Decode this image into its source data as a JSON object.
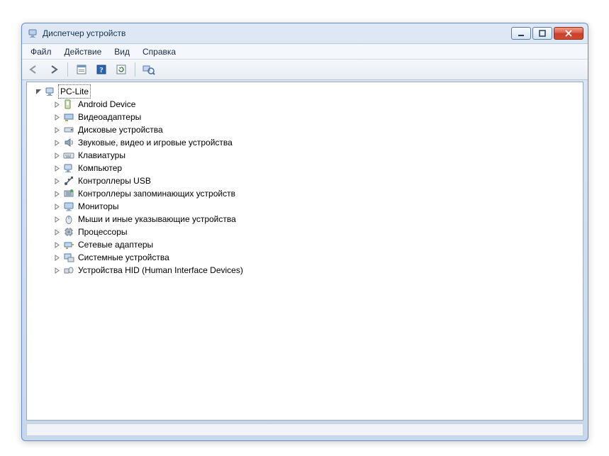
{
  "window": {
    "title": "Диспетчер устройств"
  },
  "menu": {
    "file": "Файл",
    "action": "Действие",
    "view": "Вид",
    "help": "Справка"
  },
  "toolbar": {
    "back": "Назад",
    "forward": "Вперёд",
    "properties": "Свойства",
    "help": "Справка",
    "update": "Обновить конфигурацию",
    "scan": "Обновить конфигурацию оборудования"
  },
  "tree": {
    "root": {
      "label": "PC-Lite",
      "icon": "computer-icon",
      "expanded": true
    },
    "items": [
      {
        "label": "Android Device",
        "icon": "device-icon"
      },
      {
        "label": "Видеоадаптеры",
        "icon": "display-adapter-icon"
      },
      {
        "label": "Дисковые устройства",
        "icon": "disk-drive-icon"
      },
      {
        "label": "Звуковые, видео и игровые устройства",
        "icon": "sound-icon"
      },
      {
        "label": "Клавиатуры",
        "icon": "keyboard-icon"
      },
      {
        "label": "Компьютер",
        "icon": "computer-icon"
      },
      {
        "label": "Контроллеры USB",
        "icon": "usb-icon"
      },
      {
        "label": "Контроллеры запоминающих устройств",
        "icon": "storage-controller-icon"
      },
      {
        "label": "Мониторы",
        "icon": "monitor-icon"
      },
      {
        "label": "Мыши и иные указывающие устройства",
        "icon": "mouse-icon"
      },
      {
        "label": "Процессоры",
        "icon": "cpu-icon"
      },
      {
        "label": "Сетевые адаптеры",
        "icon": "network-adapter-icon"
      },
      {
        "label": "Системные устройства",
        "icon": "system-device-icon"
      },
      {
        "label": "Устройства HID (Human Interface Devices)",
        "icon": "hid-icon"
      }
    ]
  }
}
